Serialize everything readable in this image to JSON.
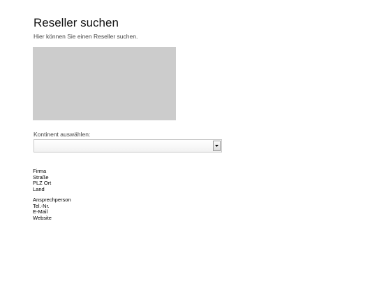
{
  "page": {
    "title": "Reseller suchen",
    "subtitle": "Hier können Sie einen Reseller suchen."
  },
  "continent_select": {
    "label": "Kontinent auswählen:",
    "selected": ""
  },
  "company_fields": [
    "Firma",
    "Straße",
    "PLZ Ort",
    "Land"
  ],
  "contact_fields": [
    "Ansprechperson",
    "Tel.-Nr.",
    "E-Mail",
    "Website"
  ],
  "icons": {
    "dropdown": "chevron-down-icon"
  }
}
